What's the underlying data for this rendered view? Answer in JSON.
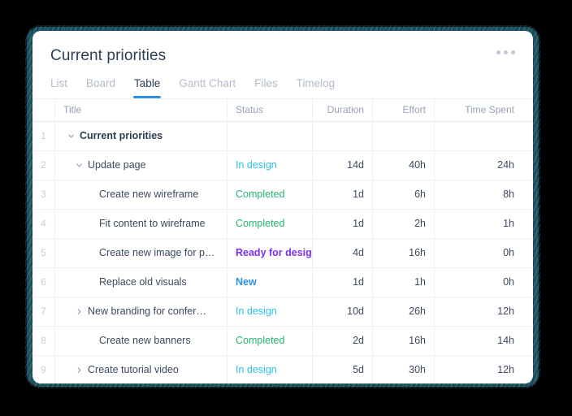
{
  "header": {
    "title": "Current priorities",
    "menu_icon": "kebab-menu-icon"
  },
  "tabs": [
    {
      "label": "List",
      "active": false
    },
    {
      "label": "Board",
      "active": false
    },
    {
      "label": "Table",
      "active": true
    },
    {
      "label": "Gantt Chart",
      "active": false
    },
    {
      "label": "Files",
      "active": false
    },
    {
      "label": "Timelog",
      "active": false
    }
  ],
  "table": {
    "columns": [
      "Title",
      "Status",
      "Duration",
      "Effort",
      "Time Spent"
    ],
    "rows": [
      {
        "num": "1",
        "title": "Current priorities",
        "level": 0,
        "chevron": "down",
        "bold": true,
        "status": "",
        "status_class": "",
        "duration": "",
        "effort": "",
        "time_spent": ""
      },
      {
        "num": "2",
        "title": "Update page",
        "level": 1,
        "chevron": "down",
        "bold": false,
        "status": "In design",
        "status_class": "st-indesign",
        "duration": "14d",
        "effort": "40h",
        "time_spent": "24h"
      },
      {
        "num": "3",
        "title": "Create new wireframe",
        "level": 2,
        "chevron": "none",
        "bold": false,
        "status": "Completed",
        "status_class": "st-completed",
        "duration": "1d",
        "effort": "6h",
        "time_spent": "8h"
      },
      {
        "num": "4",
        "title": "Fit content to wireframe",
        "level": 2,
        "chevron": "none",
        "bold": false,
        "status": "Completed",
        "status_class": "st-completed",
        "duration": "1d",
        "effort": "2h",
        "time_spent": "1h"
      },
      {
        "num": "5",
        "title": "Create new image for p…",
        "level": 2,
        "chevron": "none",
        "bold": false,
        "status": "Ready for design",
        "status_class": "st-ready",
        "duration": "4d",
        "effort": "16h",
        "time_spent": "0h"
      },
      {
        "num": "6",
        "title": "Replace old visuals",
        "level": 2,
        "chevron": "none",
        "bold": false,
        "status": "New",
        "status_class": "st-new",
        "duration": "1d",
        "effort": "1h",
        "time_spent": "0h"
      },
      {
        "num": "7",
        "title": "New branding for confer…",
        "level": 1,
        "chevron": "right",
        "bold": false,
        "status": "In design",
        "status_class": "st-indesign",
        "duration": "10d",
        "effort": "26h",
        "time_spent": "12h"
      },
      {
        "num": "8",
        "title": "Create new banners",
        "level": 2,
        "chevron": "none",
        "bold": false,
        "status": "Completed",
        "status_class": "st-completed",
        "duration": "2d",
        "effort": "16h",
        "time_spent": "14h"
      },
      {
        "num": "9",
        "title": "Create tutorial video",
        "level": 1,
        "chevron": "right",
        "bold": false,
        "status": "In design",
        "status_class": "st-indesign",
        "duration": "5d",
        "effort": "30h",
        "time_spent": "12h"
      }
    ]
  },
  "colors": {
    "accent": "#2f8fe0",
    "title": "#2c3e55",
    "muted": "#b3bcc9",
    "status_in_design": "#29c2e8",
    "status_completed": "#22b573",
    "status_ready_for_design": "#7b2ff7",
    "status_new": "#2f8fe0",
    "card_background": "#ffffff",
    "page_background": "#000000"
  }
}
